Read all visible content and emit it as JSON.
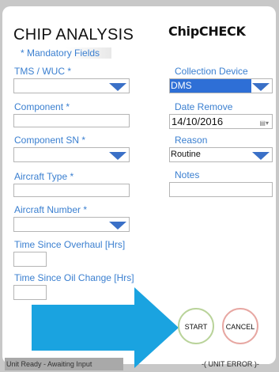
{
  "header": {
    "title": "CHIP ANALYSIS",
    "logo_text": "ChipCHECK",
    "mandatory_note": "* Mandatory Fields"
  },
  "left_fields": {
    "tms_wuc": {
      "label": "TMS / WUC *",
      "value": ""
    },
    "component": {
      "label": "Component *",
      "value": ""
    },
    "component_sn": {
      "label": "Component SN *",
      "value": ""
    },
    "aircraft_type": {
      "label": "Aircraft Type *",
      "value": ""
    },
    "aircraft_number": {
      "label": "Aircraft Number *",
      "value": ""
    },
    "time_since_overhaul": {
      "label": "Time Since Overhaul [Hrs]",
      "value": ""
    },
    "time_since_oil_change": {
      "label": "Time Since Oil Change [Hrs]",
      "value": ""
    }
  },
  "right_fields": {
    "collection_device": {
      "label": "Collection Device",
      "value": "DMS"
    },
    "date_remove": {
      "label": "Date Remove",
      "value": "14/10/2016",
      "picker_icon": "calendar-dropdown-icon"
    },
    "reason": {
      "label": "Reason",
      "value": "Routine"
    },
    "notes": {
      "label": "Notes",
      "value": ""
    }
  },
  "actions": {
    "start_label": "START",
    "cancel_label": "CANCEL"
  },
  "status_bar": {
    "status_text": "Unit Ready - Awaiting Input",
    "unit_error_text": "-( UNIT ERROR )-"
  },
  "overlay": {
    "arrow_icon": "right-arrow-icon",
    "arrow_color": "#1aa3e0"
  },
  "colors": {
    "label_blue": "#3a7fd0",
    "dropdown_arrow": "#3a70c7",
    "selected_highlight": "#2e6fd6",
    "start_ring": "#b9d39a",
    "cancel_ring": "#e7a7a2"
  }
}
